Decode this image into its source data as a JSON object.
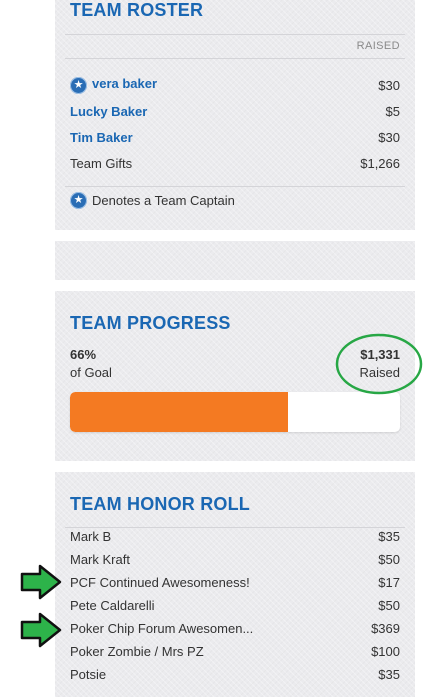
{
  "roster": {
    "title": "TEAM ROSTER",
    "raised_header": "RAISED",
    "members": [
      {
        "name": "vera baker",
        "amount": "$30",
        "captain": true,
        "link": true
      },
      {
        "name": "Lucky Baker",
        "amount": "$5",
        "captain": false,
        "link": true
      },
      {
        "name": "Tim Baker",
        "amount": "$30",
        "captain": false,
        "link": true
      },
      {
        "name": "Team Gifts",
        "amount": "$1,266",
        "captain": false,
        "link": false
      }
    ],
    "legend": "Denotes a Team Captain",
    "star_icon": "star-badge-icon"
  },
  "progress": {
    "title": "TEAM PROGRESS",
    "percent_text": "66%",
    "percent_label": "of Goal",
    "raised_amount": "$1,331",
    "raised_label": "Raised",
    "fraction": 0.66,
    "bar_color": "#f47a22",
    "highlight_color": "#27a745"
  },
  "honor_roll": {
    "title": "TEAM HONOR ROLL",
    "donors": [
      {
        "name": "Mark B",
        "amount": "$35"
      },
      {
        "name": "Mark Kraft",
        "amount": "$50"
      },
      {
        "name": "PCF Continued Awesomeness!",
        "amount": "$17"
      },
      {
        "name": "Pete Caldarelli",
        "amount": "$50"
      },
      {
        "name": "Poker Chip Forum Awesomen...",
        "amount": "$369"
      },
      {
        "name": "Poker Zombie / Mrs PZ",
        "amount": "$100"
      },
      {
        "name": "Potsie",
        "amount": "$35"
      }
    ],
    "arrow_icon": "green-arrow-icon",
    "arrow_color": "#2db34a"
  }
}
